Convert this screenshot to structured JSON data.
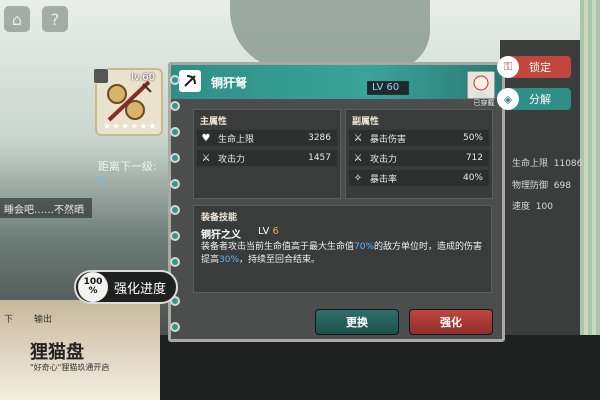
{
  "topbar": {
    "home_icon": "home-icon",
    "help_label": "?"
  },
  "side_chat": {
    "text": "睡会吧……不然晒"
  },
  "distance": {
    "label": "距离下一级:",
    "value": "0"
  },
  "item": {
    "level": "lv.60",
    "stars": "★★★★★★"
  },
  "header": {
    "name": "铜犴弩",
    "level": "LV 60",
    "equipped_label": "已穿戴"
  },
  "main_stats": {
    "title": "主属性",
    "rows": [
      {
        "icon": "heart-icon",
        "label": "生命上限",
        "value": "3286"
      },
      {
        "icon": "crossed-swords-icon",
        "label": "攻击力",
        "value": "1457"
      }
    ]
  },
  "sub_stats": {
    "title": "副属性",
    "rows": [
      {
        "icon": "crossed-swords-icon",
        "label": "暴击伤害",
        "value": "50%"
      },
      {
        "icon": "crossed-swords-icon",
        "label": "攻击力",
        "value": "712"
      },
      {
        "icon": "crit-icon",
        "label": "暴击率",
        "value": "40%"
      }
    ]
  },
  "skill": {
    "title": "装备技能",
    "name": "铜犴之义",
    "level_prefix": "LV",
    "level": "6",
    "desc_1": "装备者攻击当前生命值高于最大生命值",
    "desc_hl1": "70%",
    "desc_2": "的敌方单位时，造成的伤害提高",
    "desc_hl2": "30%",
    "desc_3": "，持续至回合结束。"
  },
  "buttons": {
    "swap": "更换",
    "upgrade": "强化",
    "lock": "锁定",
    "decompose": "分解"
  },
  "enhance": {
    "percent": "100",
    "unit": "%",
    "label": "强化进度"
  },
  "right_stats": [
    {
      "label": "生命上限",
      "value": "11086"
    },
    {
      "label": "物理防御",
      "value": "698"
    },
    {
      "label": "速度",
      "value": "100"
    }
  ],
  "bottom": {
    "title": "狸猫盘",
    "subtitle": "\"好奇心\"狸猫玖通开启",
    "tab_output": "输出",
    "tab_below": "下"
  },
  "colors": {
    "accent_teal": "#2f8f87",
    "upgrade_red": "#c0463e",
    "highlight_blue": "#5ab4ff",
    "level_gold": "#e8b23c"
  }
}
